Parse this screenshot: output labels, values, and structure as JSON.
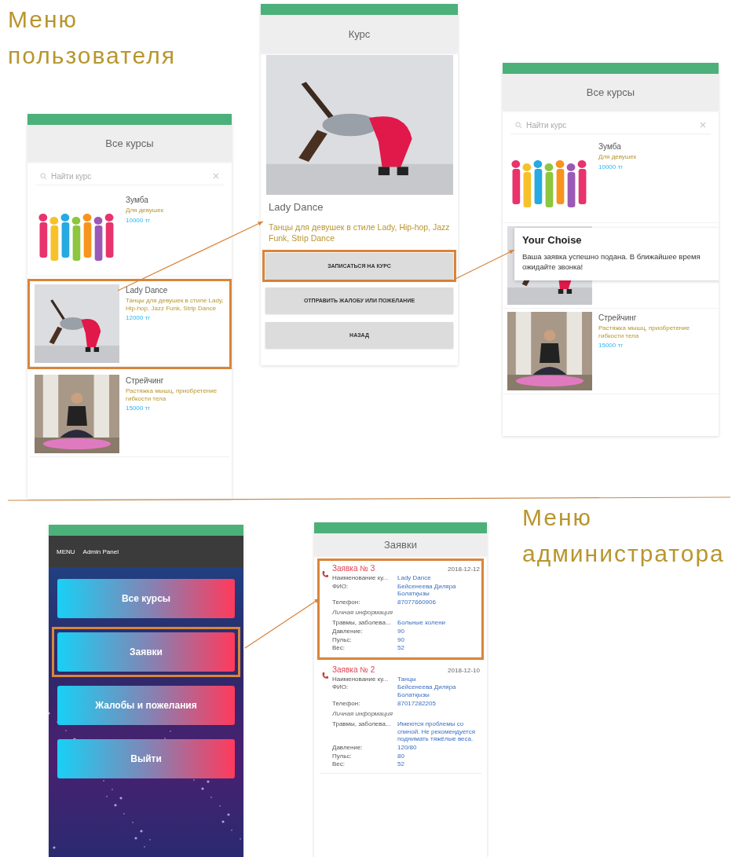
{
  "user_heading": "Меню пользователя",
  "courses_screen": {
    "title": "Все курсы",
    "search": {
      "placeholder": "Найти курс"
    },
    "courses": [
      {
        "kind": "course",
        "name": "Зумба",
        "description": "Для девушек",
        "price": "10000 тг",
        "highlighted": false
      },
      {
        "kind": "course",
        "name": "Lady Dance",
        "description": "Танцы для девушек в стиле Lady, Hip-hop, Jazz Funk, Strip Dance",
        "price": "12000 тг",
        "highlighted": true
      },
      {
        "kind": "course",
        "name": "Стрейчинг",
        "description": "Растяжка мышц, приобретение гибкости тела",
        "price": "15000 тг",
        "highlighted": false
      }
    ]
  },
  "course_screen": {
    "title": "Курс",
    "name": "Lady Dance",
    "description": "Танцы для девушек в стиле Lady, Hip-hop, Jazz Funk, Strip Dance",
    "buttons": [
      {
        "label": "ЗАПИСАТЬСЯ НА КУРС",
        "highlighted": true
      },
      {
        "label": "ОТПРАВИТЬ ЖАЛОБУ ИЛИ ПОЖЕЛАНИЕ",
        "highlighted": false
      },
      {
        "label": "НАЗАД",
        "highlighted": false
      }
    ]
  },
  "confirm_screen": {
    "title": "Все курсы",
    "search": {
      "placeholder": "Найти курс"
    },
    "courses": [
      {
        "kind": "course",
        "name": "Зумба",
        "description": "Для девушек",
        "price": "10000 тг"
      },
      {
        "kind": "picture"
      },
      {
        "kind": "course",
        "name": "Стрейчинг",
        "description": "Растяжка мышц, приобретение гибкости тела",
        "price": "15000 тг"
      }
    ],
    "dialog": {
      "title": "Your Choise",
      "message": "Ваша заявка успешно подана. В ближайшее время ожидайте звонка!"
    }
  },
  "admin_heading": "Меню администратора",
  "admin_screen": {
    "menu": "MENU",
    "title": "Admin Panel",
    "buttons": [
      {
        "label": "Все курсы",
        "highlighted": false
      },
      {
        "label": "Заявки",
        "highlighted": true
      },
      {
        "label": "Жалобы и пожелания",
        "highlighted": false
      },
      {
        "label": "Выйти",
        "highlighted": false
      }
    ]
  },
  "requests_screen": {
    "title": "Заявки",
    "requests": [
      {
        "title": "Заявка № 3",
        "date": "2018-12-12",
        "highlighted": true,
        "fields": [
          {
            "label": "Наименование ку...",
            "value": "Lady Dance"
          },
          {
            "label": "ФИО:",
            "value": "Бейсенеева Диляра Болатқызы"
          },
          {
            "label": "Телефон:",
            "value": "87077660906"
          }
        ],
        "section": "Личная информация",
        "health": [
          {
            "label": "Травмы, заболева...",
            "value": "Больные колени"
          },
          {
            "label": "Давление:",
            "value": "90"
          },
          {
            "label": "Пульс:",
            "value": "90"
          },
          {
            "label": "Вес:",
            "value": "52"
          }
        ]
      },
      {
        "title": "Заявка № 2",
        "date": "2018-12-10",
        "highlighted": false,
        "fields": [
          {
            "label": "Наименование ку...",
            "value": "Танцы"
          },
          {
            "label": "ФИО:",
            "value": "Бейсенеева Диляра Болатқызы"
          },
          {
            "label": "Телефон:",
            "value": "87017282205"
          }
        ],
        "section": "Личная информация",
        "health": [
          {
            "label": "Травмы, заболева...",
            "value": "Имеются проблемы со спиной. Не рекомендуется поднимать тяжёлые веса."
          },
          {
            "label": "Давление:",
            "value": "120/80"
          },
          {
            "label": "Пульс:",
            "value": "80"
          },
          {
            "label": "Вес:",
            "value": "52"
          }
        ]
      }
    ]
  }
}
